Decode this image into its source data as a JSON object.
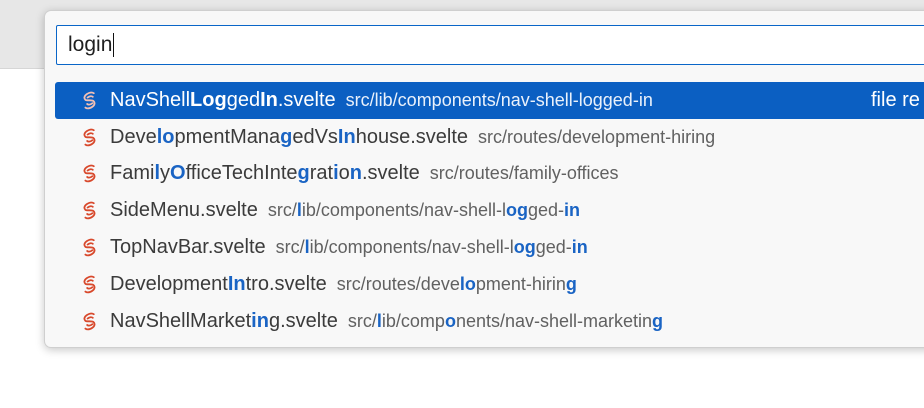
{
  "search": {
    "value": "login"
  },
  "results": [
    {
      "selected": true,
      "name": [
        [
          "NavShell",
          false
        ],
        [
          "Log",
          true
        ],
        [
          "ged",
          false
        ],
        [
          "In",
          true
        ],
        [
          ".svelte",
          false
        ]
      ],
      "path": [
        [
          "src/lib/components/nav-shell-logged-in",
          false
        ]
      ],
      "hint": "file re"
    },
    {
      "name": [
        [
          "Deve",
          false
        ],
        [
          "lo",
          true
        ],
        [
          "pmentMana",
          false
        ],
        [
          "g",
          true
        ],
        [
          "edVs",
          false
        ],
        [
          "In",
          true
        ],
        [
          "house.svelte",
          false
        ]
      ],
      "path": [
        [
          "src/routes/development-hiring",
          false
        ]
      ]
    },
    {
      "name": [
        [
          "Fami",
          false
        ],
        [
          "l",
          true
        ],
        [
          "y",
          false
        ],
        [
          "O",
          true
        ],
        [
          "fficeTechInte",
          false
        ],
        [
          "g",
          true
        ],
        [
          "rat",
          false
        ],
        [
          "i",
          true
        ],
        [
          "o",
          false
        ],
        [
          "n",
          true
        ],
        [
          ".svelte",
          false
        ]
      ],
      "path": [
        [
          "src/routes/family-offices",
          false
        ]
      ]
    },
    {
      "name": [
        [
          "SideMenu.svelte",
          false
        ]
      ],
      "path": [
        [
          "src/",
          false
        ],
        [
          "l",
          true
        ],
        [
          "ib/components/nav-shell-l",
          false
        ],
        [
          "og",
          true
        ],
        [
          "ged-",
          false
        ],
        [
          "in",
          true
        ]
      ]
    },
    {
      "name": [
        [
          "TopNavBar.svelte",
          false
        ]
      ],
      "path": [
        [
          "src/",
          false
        ],
        [
          "l",
          true
        ],
        [
          "ib/components/nav-shell-l",
          false
        ],
        [
          "og",
          true
        ],
        [
          "ged-",
          false
        ],
        [
          "in",
          true
        ]
      ]
    },
    {
      "name": [
        [
          "Development",
          false
        ],
        [
          "In",
          true
        ],
        [
          "tro.svelte",
          false
        ]
      ],
      "path": [
        [
          "src/routes/deve",
          false
        ],
        [
          "lo",
          true
        ],
        [
          "pment-hirin",
          false
        ],
        [
          "g",
          true
        ]
      ]
    },
    {
      "name": [
        [
          "NavShellMarket",
          false
        ],
        [
          "in",
          true
        ],
        [
          "g.svelte",
          false
        ]
      ],
      "path": [
        [
          "src/",
          false
        ],
        [
          "l",
          true
        ],
        [
          "ib/comp",
          false
        ],
        [
          "o",
          true
        ],
        [
          "nents/nav-shell-marketin",
          false
        ],
        [
          "g",
          true
        ]
      ]
    }
  ],
  "icons": {
    "file": "svelte-file-icon"
  },
  "colors": {
    "accent": "#0b5fc2",
    "match": "#1a64c4",
    "svelte": "#d8492c"
  }
}
